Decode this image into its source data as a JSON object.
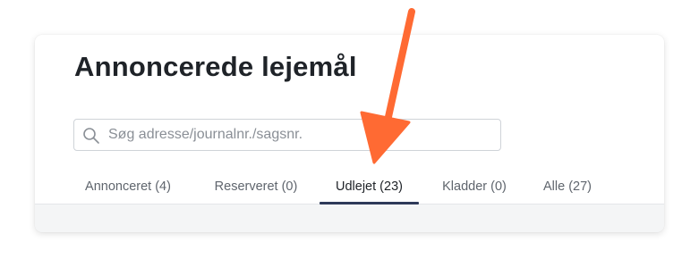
{
  "page": {
    "title": "Annoncerede lejemål"
  },
  "search": {
    "placeholder": "Søg adresse/journalnr./sagsnr.",
    "value": "",
    "icon": "search-icon"
  },
  "tabs": [
    {
      "label": "Annonceret (4)",
      "active": false
    },
    {
      "label": "Reserveret (0)",
      "active": false
    },
    {
      "label": "Udlejet (23)",
      "active": true
    },
    {
      "label": "Kladder (0)",
      "active": false
    },
    {
      "label": "Alle (27)",
      "active": false
    }
  ],
  "annotation": {
    "icon": "arrow-annotation-icon",
    "color": "#ff6a33"
  },
  "colors": {
    "active_tab_underline": "#2e3a59",
    "footer_band": "#f4f5f6"
  }
}
